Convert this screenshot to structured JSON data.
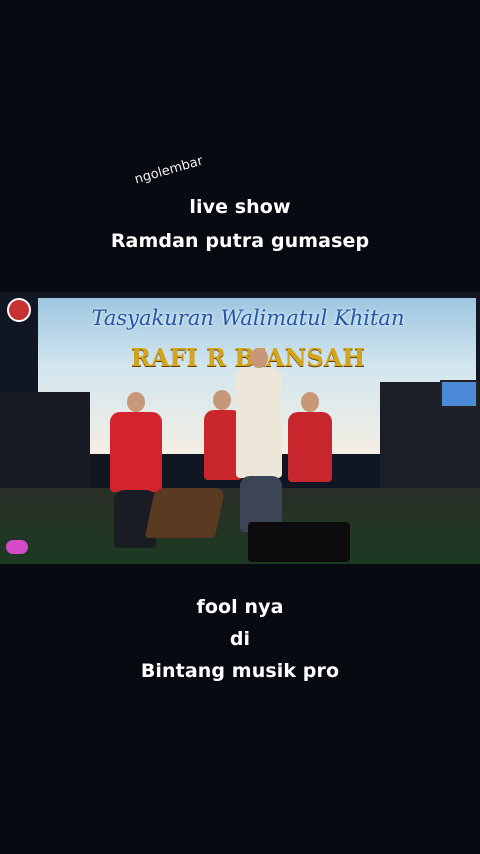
{
  "overlay": {
    "tag": "ngolembar",
    "line1": "live show",
    "line2": "Ramdan putra gumasep",
    "line3": "fool nya",
    "line4": "di",
    "line5": "Bintang musik pro"
  },
  "video": {
    "banner_title": "Tasyakuran Walimatul Khitan",
    "banner_name": "RAFI R  BIANSAH"
  },
  "colors": {
    "background": "#070a10",
    "banner_blue": "#2557a8",
    "banner_gold": "#d4a51a",
    "performer_red": "#d3232c"
  }
}
